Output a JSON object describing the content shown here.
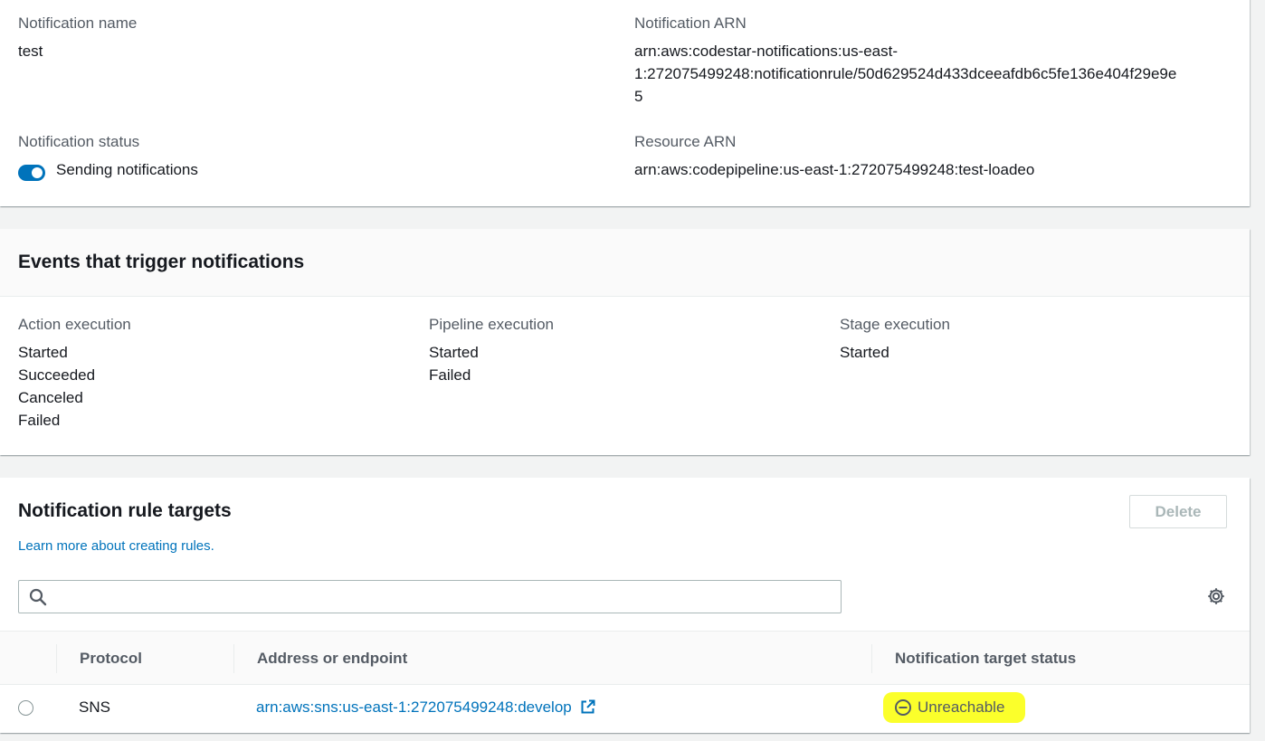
{
  "details": {
    "name_label": "Notification name",
    "name_value": "test",
    "arn_label": "Notification ARN",
    "arn_lines": [
      "arn:aws:codestar-notifications:us-east-",
      "1:272075499248:notificationrule/50d629524d433dceeafdb6c5fe136e404f29e9e",
      "5"
    ],
    "status_label": "Notification status",
    "status_value": "Sending notifications",
    "status_enabled": true,
    "resource_label": "Resource ARN",
    "resource_value": "arn:aws:codepipeline:us-east-1:272075499248:test-loadeo"
  },
  "events": {
    "title": "Events that trigger notifications",
    "groups": [
      {
        "label": "Action execution",
        "items": [
          "Started",
          "Succeeded",
          "Canceled",
          "Failed"
        ]
      },
      {
        "label": "Pipeline execution",
        "items": [
          "Started",
          "Failed"
        ]
      },
      {
        "label": "Stage execution",
        "items": [
          "Started"
        ]
      }
    ]
  },
  "targets": {
    "title": "Notification rule targets",
    "learn_more": "Learn more about creating rules.",
    "delete_label": "Delete",
    "search_value": "",
    "columns": [
      "Protocol",
      "Address or endpoint",
      "Notification target status"
    ],
    "rows": [
      {
        "protocol": "SNS",
        "address": "arn:aws:sns:us-east-1:272075499248:develop",
        "status": "Unreachable"
      }
    ]
  },
  "icons": {
    "search": "search-icon",
    "settings": "gear-icon",
    "external": "external-link-icon",
    "status": "minus-circle-icon"
  },
  "colors": {
    "accent": "#0073bb",
    "highlight": "#fbff2b",
    "status_unreachable": "#687078"
  }
}
